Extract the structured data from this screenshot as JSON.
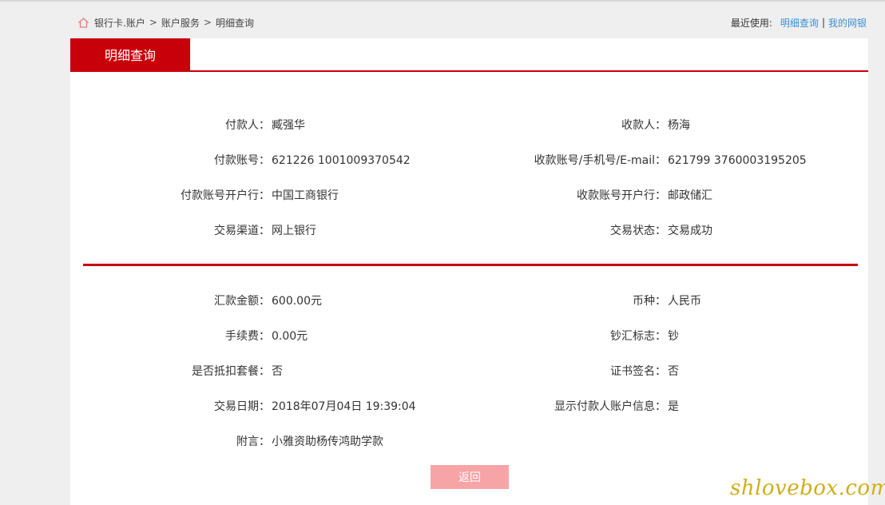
{
  "breadcrumb": {
    "icon": "home-icon",
    "items": [
      "银行卡.账户",
      "账户服务",
      "明细查询"
    ],
    "separator": ">"
  },
  "recent": {
    "label": "最近使用:",
    "links": [
      "明细查询",
      "我的网银"
    ],
    "separator": "|",
    "link_color": "#3b8fd1"
  },
  "panel": {
    "tab_label": "明细查询",
    "accent_color": "#c8000a"
  },
  "transfer_info": [
    {
      "left_label": "付款人：",
      "left_value": "臧强华",
      "right_label": "收款人：",
      "right_value": "杨海"
    },
    {
      "left_label": "付款账号：",
      "left_value": "621226 1001009370542",
      "right_label": "收款账号/手机号/E-mail：",
      "right_value": "621799 3760003195205"
    },
    {
      "left_label": "付款账号开户行：",
      "left_value": "中国工商银行",
      "right_label": "收款账号开户行：",
      "right_value": "邮政储汇"
    },
    {
      "left_label": "交易渠道：",
      "left_value": "网上银行",
      "right_label": "交易状态：",
      "right_value": "交易成功"
    }
  ],
  "amount_info": [
    {
      "left_label": "汇款金额：",
      "left_value": "600.00元",
      "right_label": "币种：",
      "right_value": "人民币"
    },
    {
      "left_label": "手续费：",
      "left_value": "0.00元",
      "right_label": "钞汇标志：",
      "right_value": "钞"
    },
    {
      "left_label": "是否抵扣套餐：",
      "left_value": "否",
      "right_label": "证书签名：",
      "right_value": "否"
    },
    {
      "left_label": "交易日期：",
      "left_value": "2018年07月04日 19:39:04",
      "right_label": "显示付款人账户信息：",
      "right_value": "是"
    },
    {
      "left_label": "附言：",
      "left_value": "小雅资助杨传鸿助学款",
      "right_label": "",
      "right_value": ""
    }
  ],
  "back_button_label": "返回",
  "back_button_color": "#f7a4a7",
  "watermark": "shlovebox.com"
}
